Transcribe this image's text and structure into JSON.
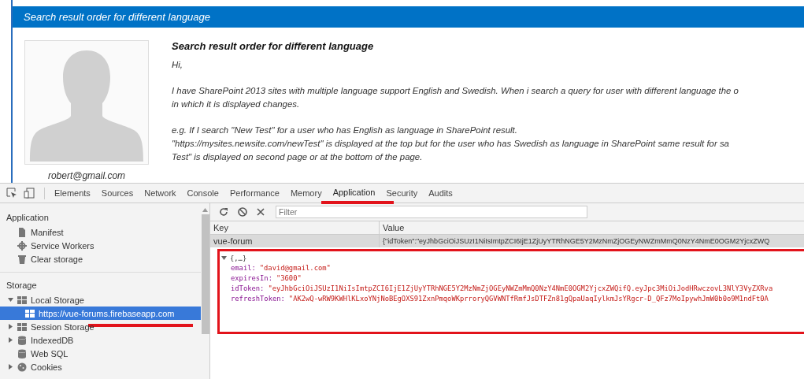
{
  "post": {
    "header": "Search result order for different language",
    "title": "Search result order for different language",
    "author_email": "robert@gmail.com",
    "paragraphs": [
      [
        "Hi,"
      ],
      [
        "I have SharePoint 2013 sites with multiple language support English and Swedish. When i search a query for user with different language the o",
        "in which it is displayed changes."
      ],
      [
        "e.g. If I search \"New Test\" for a user who has English as language in SharePoint result.",
        "\"https://mysites.newsite.com/newTest\" is displayed at the top but for the user who has Swedish as language in SharePoint same result for sa",
        "Test\" is displayed on second page or at the bottom of the page."
      ]
    ]
  },
  "devtools": {
    "tabs": [
      {
        "label": "Elements",
        "selected": false
      },
      {
        "label": "Sources",
        "selected": false
      },
      {
        "label": "Network",
        "selected": false
      },
      {
        "label": "Console",
        "selected": false
      },
      {
        "label": "Performance",
        "selected": false
      },
      {
        "label": "Memory",
        "selected": false
      },
      {
        "label": "Application",
        "selected": true
      },
      {
        "label": "Security",
        "selected": false
      },
      {
        "label": "Audits",
        "selected": false
      }
    ],
    "sidebar": {
      "sections": [
        {
          "title": "Application",
          "items": [
            {
              "label": "Manifest",
              "kind": "file"
            },
            {
              "label": "Service Workers",
              "kind": "gear"
            },
            {
              "label": "Clear storage",
              "kind": "trash"
            }
          ]
        },
        {
          "title": "Storage",
          "items": [
            {
              "label": "Local Storage",
              "kind": "grid",
              "expanded": true,
              "children": [
                {
                  "label": "https://vue-forums.firebaseapp.com",
                  "selected": true
                }
              ]
            },
            {
              "label": "Session Storage",
              "kind": "grid",
              "expanded": false
            },
            {
              "label": "IndexedDB",
              "kind": "database",
              "expanded": false
            },
            {
              "label": "Web SQL",
              "kind": "database"
            },
            {
              "label": "Cookies",
              "kind": "cookie",
              "expanded": false
            }
          ]
        }
      ]
    },
    "filter": {
      "placeholder": "Filter"
    },
    "table": {
      "columns": [
        "Key",
        "Value"
      ],
      "rows": [
        {
          "key": "vue-forum",
          "value": "{\"idToken\":\"eyJhbGciOiJSUzI1NiIsImtpZCI6IjE1ZjUyYTRhNGE5Y2MzNmZjOGEyNWZmMmQ0NzY4NmE0OGM2YjcxZWQ",
          "selected": true
        }
      ]
    },
    "preview": {
      "summary": "{,…}",
      "expanded": true,
      "entries": [
        {
          "key": "email:",
          "value": "\"david@gmail.com\""
        },
        {
          "key": "expiresIn:",
          "value": "\"3600\""
        },
        {
          "key": "idToken:",
          "value": "\"eyJhbGciOiJSUzI1NiIsImtpZCI6IjE1ZjUyYTRhNGE5Y2MzNmZjOGEyNWZmMmQ0NzY4NmE0OGM2YjcxZWQifQ.eyJpc3MiOiJodHRwczovL3NlY3VyZXRva"
        },
        {
          "key": "refreshToken:",
          "value": "\"AK2wQ-wRW9KWHlKLxoYNjNoBEgOXS91ZxnPmqoWKprroryQGVWNTfRmfJsDTFZn81gQpaUaqIylkmJsYRgcr-D_QFz7MoIpywhJmW0b0o9M1ndFt0A"
        }
      ]
    }
  }
}
